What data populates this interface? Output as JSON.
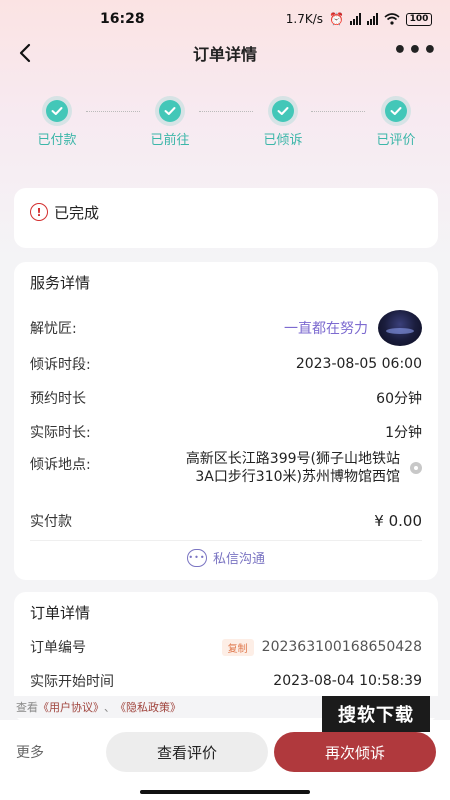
{
  "status_bar": {
    "time": "16:28",
    "network_speed": "1.7K/s",
    "battery": "100",
    "icons": [
      "alarm-icon",
      "signal-icon",
      "wifi-icon",
      "battery-icon"
    ]
  },
  "nav": {
    "back_icon": "back-arrow-icon",
    "title": "订单详情",
    "more_label": "•••"
  },
  "steps": [
    {
      "label": "已付款",
      "done": true
    },
    {
      "label": "已前往",
      "done": true
    },
    {
      "label": "已倾诉",
      "done": true
    },
    {
      "label": "已评价",
      "done": true
    }
  ],
  "order_status": {
    "icon": "alert-circle-icon",
    "text": "已完成"
  },
  "service": {
    "title": "服务详情",
    "helper_label": "解忧匠:",
    "helper_name": "一直都在努力",
    "period_label": "倾诉时段:",
    "period_value": "2023-08-05 06:00",
    "booked_label": "预约时长",
    "booked_value": "60分钟",
    "actual_label": "实际时长:",
    "actual_value": "1分钟",
    "address_label": "倾诉地点:",
    "address_line1": "高新区长江路399号(狮子山地铁站",
    "address_line2": "3A口步行310米)苏州博物馆西馆",
    "paid_label": "实付款",
    "paid_value": "¥ 0.00",
    "chat_label": "私信沟通"
  },
  "order": {
    "title": "订单详情",
    "number_label": "订单编号",
    "copy_label": "复制",
    "number_value": "202363100168650428",
    "start_label": "实际开始时间",
    "start_value": "2023-08-04 10:58:39"
  },
  "agreement": {
    "prefix": "查看",
    "user_agreement": "《用户协议》",
    "separator": "、",
    "privacy_policy": "《隐私政策》"
  },
  "watermark": "搜软下载",
  "bottom": {
    "more_label": "更多",
    "review_label": "查看评价",
    "again_label": "再次倾诉"
  },
  "colors": {
    "accent_teal": "#43c7b8",
    "accent_red": "#b0393d",
    "price_red": "#d32f2f",
    "helper_purple": "#7d6bd0"
  }
}
